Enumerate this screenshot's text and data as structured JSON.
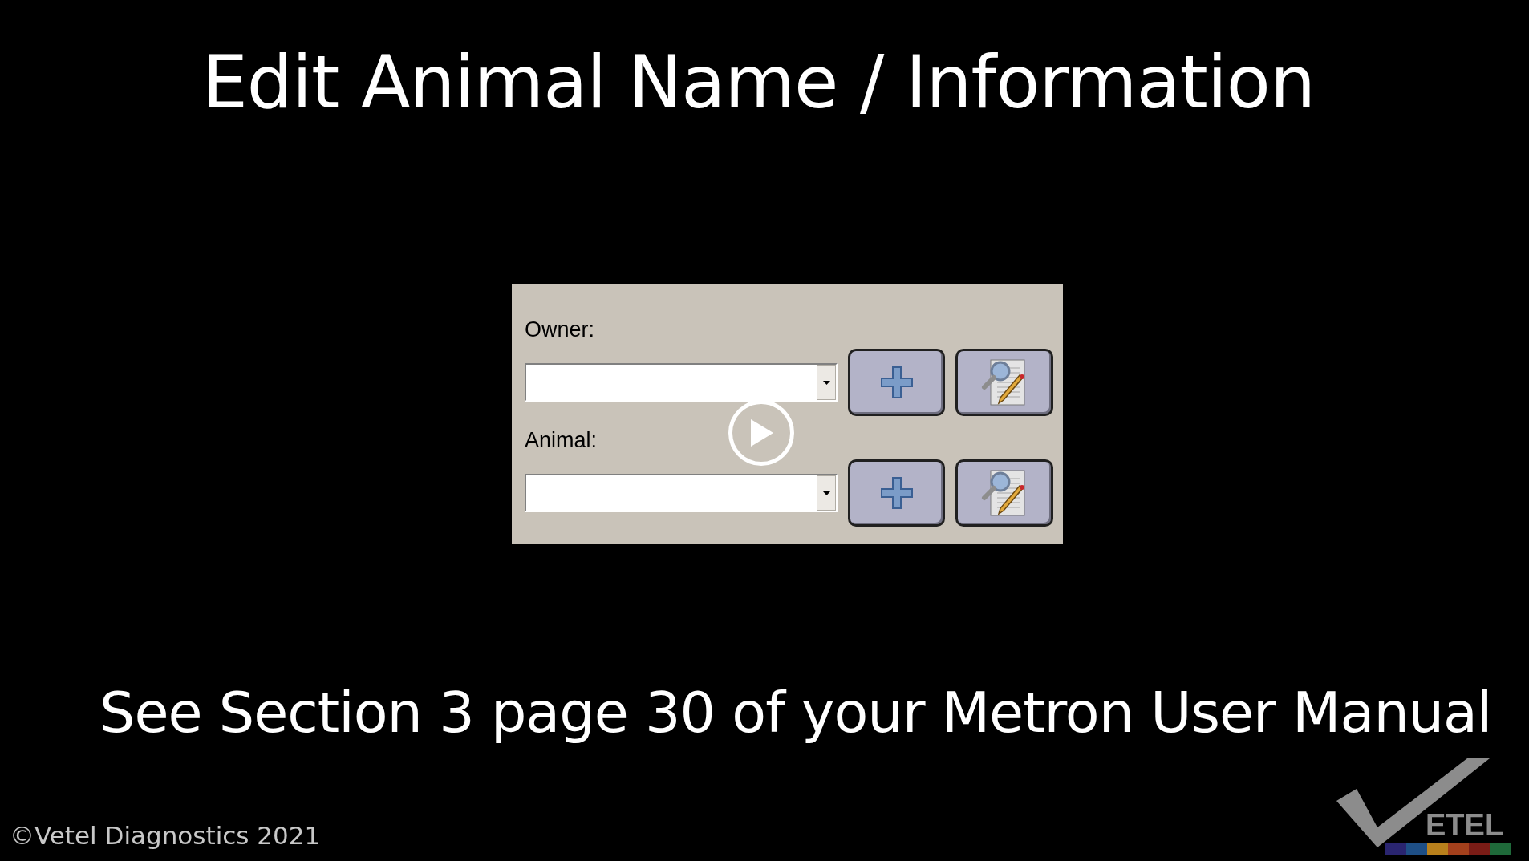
{
  "title": "Edit Animal Name / Information",
  "dialog": {
    "rows": [
      {
        "label": "Owner:"
      },
      {
        "label": "Animal:"
      }
    ]
  },
  "caption": "See Section 3 page 30 of your Metron User Manual",
  "copyright": "©Vetel Diagnostics 2021",
  "logo": {
    "text": "ETEL",
    "stripes": [
      {
        "color": "#2a2570"
      },
      {
        "color": "#1e4f86"
      },
      {
        "color": "#b8801c"
      },
      {
        "color": "#a3401c"
      },
      {
        "color": "#7a1c16"
      },
      {
        "color": "#1f6a3a"
      }
    ]
  }
}
